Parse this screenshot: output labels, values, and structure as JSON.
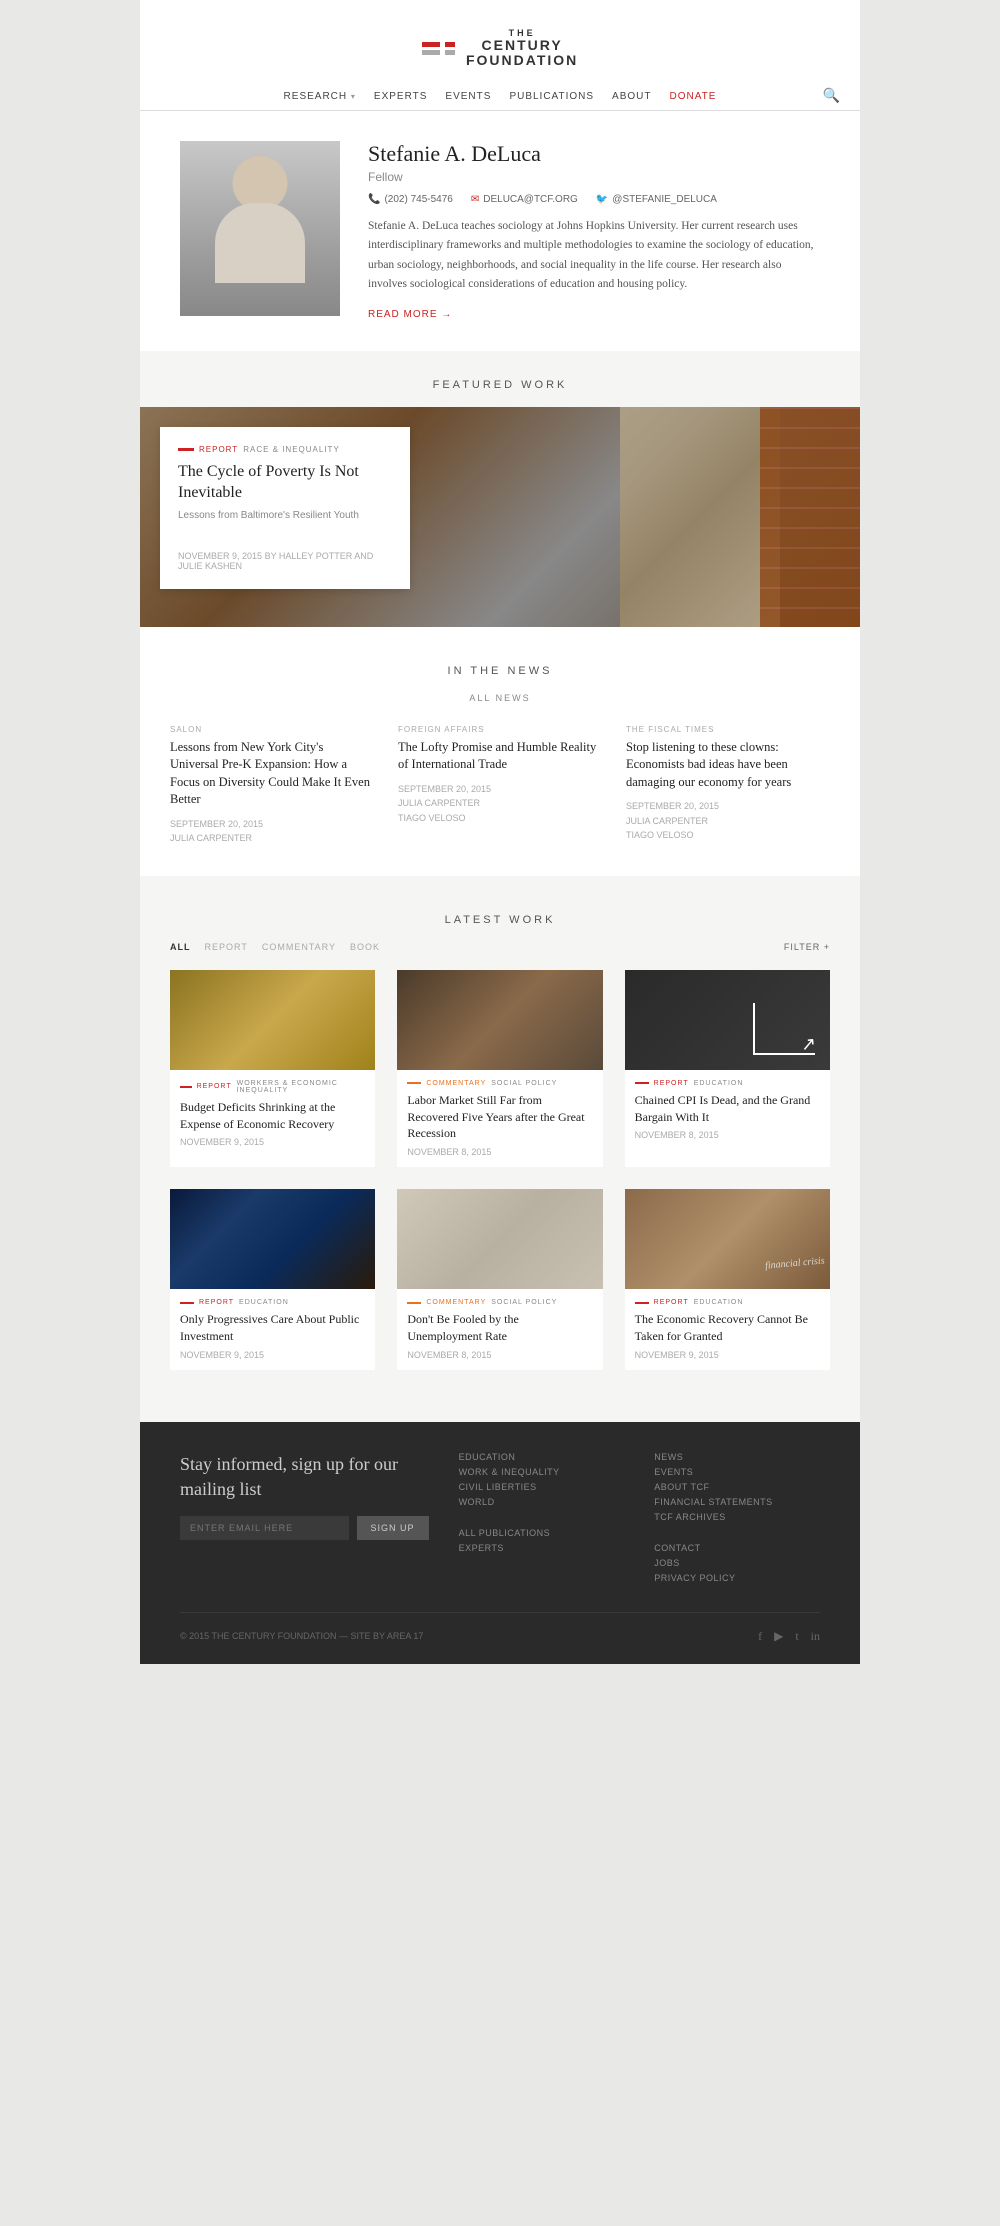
{
  "site": {
    "name": "THE CENTURY FOUNDATION",
    "name_the": "THE",
    "name_org": "CENTURY\nFOUNDATION"
  },
  "nav": {
    "links": [
      {
        "label": "RESEARCH",
        "has_dropdown": true
      },
      {
        "label": "EXPERTS",
        "has_dropdown": false
      },
      {
        "label": "EVENTS",
        "has_dropdown": false
      },
      {
        "label": "PUBLICATIONS",
        "has_dropdown": false
      },
      {
        "label": "ABOUT",
        "has_dropdown": false
      },
      {
        "label": "DONATE",
        "is_donate": true
      }
    ]
  },
  "profile": {
    "name": "Stefanie A. DeLuca",
    "title": "Fellow",
    "phone": "(202) 745-5476",
    "email": "DELUCA@TCF.ORG",
    "twitter": "@STEFANIE_DELUCA",
    "bio": "Stefanie A. DeLuca teaches sociology at Johns Hopkins University. Her current research uses interdisciplinary frameworks and multiple methodologies to examine the sociology of education, urban sociology, neighborhoods, and social inequality in the life course. Her research also involves sociological considerations of education and housing policy.",
    "read_more": "READ MORE →"
  },
  "featured": {
    "section_title": "FEATURED WORK",
    "tag": "REPORT",
    "category": "RACE & INEQUALITY",
    "title": "The Cycle of Poverty Is Not Inevitable",
    "subtitle": "Lessons from Baltimore's Resilient Youth",
    "date": "NOVEMBER 9, 2015",
    "by": "BY HALLEY POTTER AND JULIE KASHEN"
  },
  "in_the_news": {
    "section_title": "IN THE NEWS",
    "all_news_label": "ALL NEWS",
    "items": [
      {
        "source": "SALON",
        "title": "Lessons from New York City's Universal Pre-K Expansion: How a Focus on Diversity Could Make It Even Better",
        "date": "SEPTEMBER 20, 2015",
        "author": "JULIA CARPENTER"
      },
      {
        "source": "FOREIGN AFFAIRS",
        "title": "The Lofty Promise and Humble Reality of International Trade",
        "date": "SEPTEMBER 20, 2015",
        "author1": "JULIA CARPENTER",
        "author2": "TIAGO VELOSO"
      },
      {
        "source": "THE FISCAL TIMES",
        "title": "Stop listening to these clowns: Economists bad ideas have been damaging our economy for years",
        "date": "SEPTEMBER 20, 2015",
        "author1": "JULIA CARPENTER",
        "author2": "TIAGO VELOSO"
      }
    ]
  },
  "latest_work": {
    "section_title": "LATEST WORK",
    "filter_tabs": [
      "ALL",
      "REPORT",
      "COMMENTARY",
      "BOOK"
    ],
    "filter_label": "FILTER +",
    "items": [
      {
        "thumb_type": "money",
        "tag_type": "red",
        "tag_label": "REPORT",
        "tag_category": "WORKERS & ECONOMIC INEQUALITY",
        "title": "Budget Deficits Shrinking at the Expense of Economic Recovery",
        "date": "NOVEMBER 9, 2015"
      },
      {
        "thumb_type": "people",
        "tag_type": "orange",
        "tag_label": "COMMENTARY",
        "tag_category": "SOCIAL POLICY",
        "title": "Labor Market Still Far from Recovered Five Years after the Great Recession",
        "date": "NOVEMBER 8, 2015"
      },
      {
        "thumb_type": "chart",
        "tag_type": "red",
        "tag_label": "REPORT",
        "tag_category": "EDUCATION",
        "title": "Chained CPI Is Dead, and the Grand Bargain With It",
        "date": "NOVEMBER 8, 2015"
      },
      {
        "thumb_type": "city",
        "tag_type": "red",
        "tag_label": "REPORT",
        "tag_category": "EDUCATION",
        "title": "Only Progressives Care About Public Investment",
        "date": "NOVEMBER 9, 2015"
      },
      {
        "thumb_type": "map",
        "tag_type": "orange",
        "tag_label": "COMMENTARY",
        "tag_category": "SOCIAL POLICY",
        "title": "Don't Be Fooled by the Unemployment Rate",
        "date": "NOVEMBER 8, 2015"
      },
      {
        "thumb_type": "crisis",
        "tag_type": "red",
        "tag_label": "REPORT",
        "tag_category": "EDUCATION",
        "title": "The Economic Recovery Cannot Be Taken for Granted",
        "date": "NOVEMBER 9, 2015"
      }
    ]
  },
  "footer": {
    "mailing_title": "Stay informed, sign up for our mailing list",
    "email_placeholder": "ENTER EMAIL HERE",
    "signup_label": "SIGN UP",
    "col1_links": [
      "EDUCATION",
      "WORK & INEQUALITY",
      "CIVIL LIBERTIES",
      "WORLD",
      "ALL PUBLICATIONS",
      "EXPERTS"
    ],
    "col2_title": "NEWS",
    "col2_links": [
      "NEWS",
      "EVENTS",
      "ABOUT TCF",
      "FINANCIAL STATEMENTS",
      "TCF ARCHIVES",
      "CONTACT",
      "JOBS",
      "PRIVACY POLICY"
    ],
    "copyright": "© 2015 THE CENTURY FOUNDATION — SITE BY AREA 17",
    "social_icons": [
      "f",
      "▶",
      "t",
      "in"
    ]
  }
}
